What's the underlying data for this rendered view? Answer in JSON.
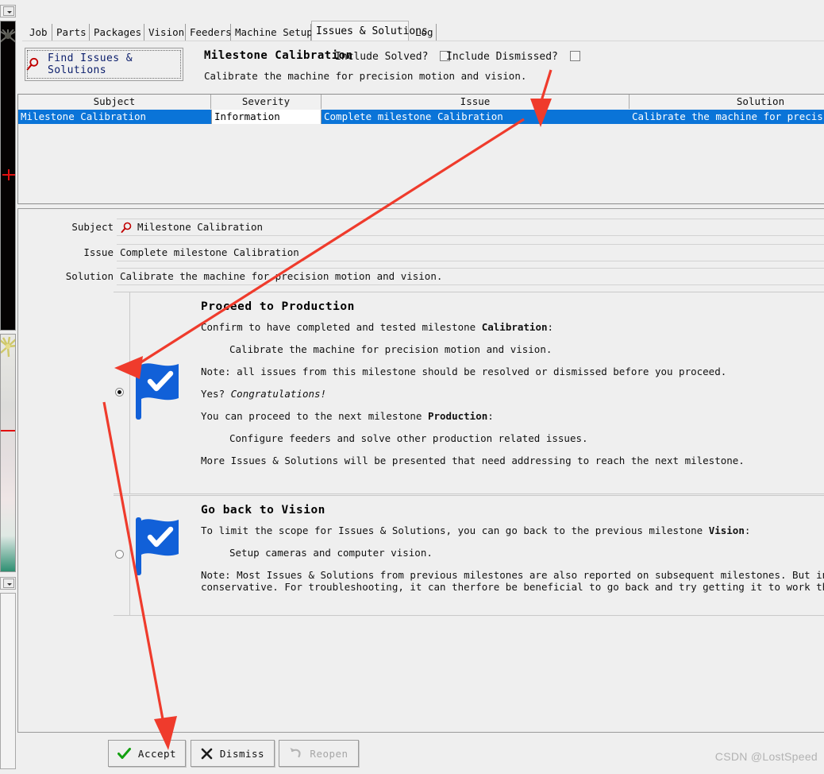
{
  "app": {
    "tabs": [
      {
        "label": "Job",
        "active": false
      },
      {
        "label": "Parts",
        "active": false
      },
      {
        "label": "Packages",
        "active": false
      },
      {
        "label": "Vision",
        "active": false
      },
      {
        "label": "Feeders",
        "active": false
      },
      {
        "label": "Machine Setup",
        "active": false
      },
      {
        "label": "Issues & Solutions",
        "active": true
      },
      {
        "label": "Log",
        "active": false
      }
    ]
  },
  "toolbar": {
    "find_button_label": "Find Issues & Solutions",
    "find_icon": "magnifier-icon",
    "milestone_title": "Milestone Calibration",
    "milestone_description": "Calibrate the machine for precision motion and vision.",
    "include_solved_label": "Include Solved?",
    "include_solved_checked": false,
    "include_dismissed_label": "Include Dismissed?",
    "include_dismissed_checked": false
  },
  "table": {
    "columns": [
      "Subject",
      "Severity",
      "Issue",
      "Solution"
    ],
    "rows": [
      {
        "subject": "Milestone Calibration",
        "severity": "Information",
        "issue": "Complete milestone Calibration",
        "solution": "Calibrate the machine for precision motio",
        "selected": true
      }
    ]
  },
  "detail": {
    "subject_label": "Subject",
    "subject_value": "Milestone Calibration",
    "subject_icon": "magnifier-icon",
    "issue_label": "Issue",
    "issue_value": "Complete milestone Calibration",
    "solution_label": "Solution",
    "solution_value": "Calibrate the machine for precision motion and vision."
  },
  "options": [
    {
      "selected": true,
      "icon": "blue-flag-check-icon",
      "heading": "Proceed to Production",
      "line1_a": "Confirm to have completed and tested milestone ",
      "line1_b": "Calibration",
      "line1_c": ":",
      "indent1": "Calibrate the machine for precision motion and vision.",
      "note": "Note: all issues from this milestone should be resolved or dismissed before you proceed.",
      "congrats_a": "Yes? ",
      "congrats_b": "Congratulations!",
      "line2_a": "You can proceed to the next milestone ",
      "line2_b": "Production",
      "line2_c": ":",
      "indent2": "Configure feeders and solve other production related issues.",
      "footer": "More Issues & Solutions will be presented that need addressing to reach the next milestone."
    },
    {
      "selected": false,
      "icon": "blue-flag-check-icon",
      "heading": "Go back to Vision",
      "line1_a": "To limit the scope for Issues & Solutions, you can go back to the previous milestone ",
      "line1_b": "Vision",
      "line1_c": ":",
      "indent1": "Setup cameras and computer vision.",
      "note_line1": "Note: Most Issues & Solutions from previous milestones are also reported on subsequent milestones. But in earlier target milestone",
      "note_line2": "conservative. For troubleshooting, it can therfore be beneficial to go back and try getting it to work there."
    }
  ],
  "actions": {
    "accept_label": "Accept",
    "accept_icon": "check-icon",
    "dismiss_label": "Dismiss",
    "dismiss_icon": "x-icon",
    "reopen_label": "Reopen",
    "reopen_icon": "undo-arrow-icon",
    "reopen_disabled": true
  },
  "watermark": "CSDN @LostSpeed",
  "colors": {
    "selection": "#0a74d8",
    "flag": "#1160d8",
    "accent_red": "#c00000",
    "link_text": "#0a1d6b"
  }
}
